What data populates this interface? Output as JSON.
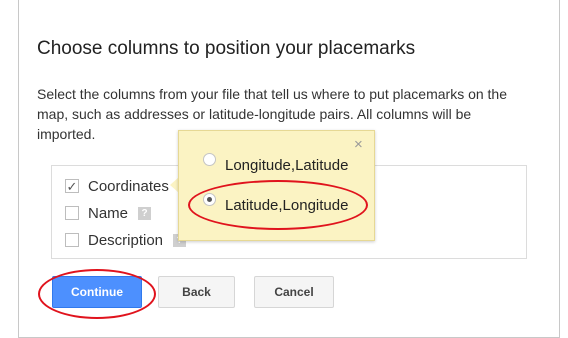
{
  "dialog": {
    "title": "Choose columns to position your placemarks",
    "description": "Select the columns from your file that tell us where to put placemarks on the map, such as addresses or latitude-longitude pairs. All columns will be imported."
  },
  "columns": [
    {
      "label": "Coordinates",
      "checked": true
    },
    {
      "label": "Name",
      "checked": false,
      "help": "?"
    },
    {
      "label": "Description",
      "checked": false,
      "help": "?"
    }
  ],
  "popup": {
    "close_symbol": "×",
    "options": [
      {
        "label": "Longitude,Latitude",
        "selected": false
      },
      {
        "label": "Latitude,Longitude",
        "selected": true
      }
    ]
  },
  "buttons": {
    "continue": "Continue",
    "back": "Back",
    "cancel": "Cancel"
  },
  "check_mark": "✓",
  "colors": {
    "primary_button": "#4d90fe",
    "popup_background": "#fbf3c3",
    "highlight_ellipse": "#e0131d"
  },
  "icons": {
    "close": "close-icon",
    "help": "help-icon",
    "checkbox": "checkbox",
    "radio": "radio-button"
  }
}
